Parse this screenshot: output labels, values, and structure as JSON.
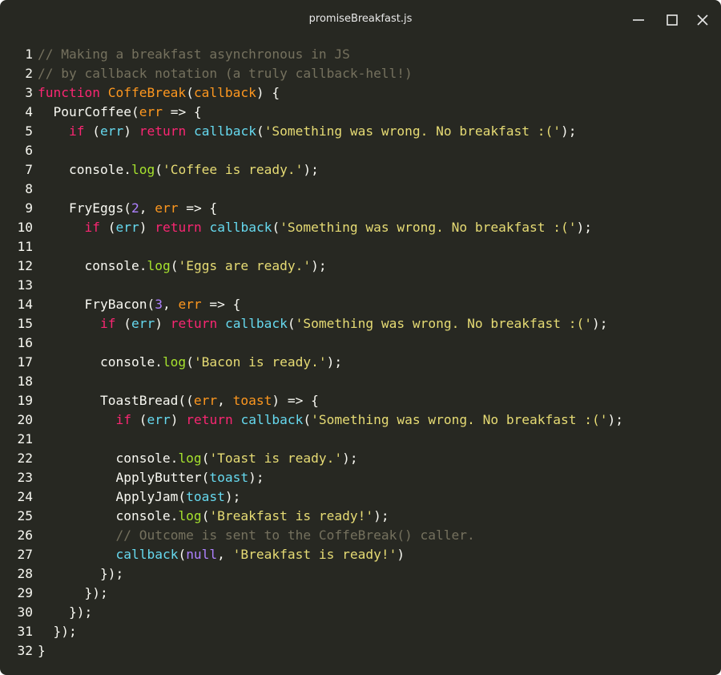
{
  "window": {
    "title": "promiseBreakfast.js",
    "controls": {
      "minimize_icon": "minimize-icon",
      "maximize_icon": "maximize-icon",
      "close_icon": "close-icon"
    }
  },
  "colors": {
    "background": "#272822",
    "default": "#f8f8f2",
    "comment": "#75715e",
    "keyword": "#f92672",
    "function_name": "#fd971f",
    "param": "#fd971f",
    "builtin": "#66d9ef",
    "method": "#a6e22e",
    "string": "#e6db74",
    "number": "#ae81ff"
  },
  "editor": {
    "lines": [
      {
        "num": "1",
        "tokens": [
          [
            "comment",
            "// Making a breakfast asynchronous in JS"
          ]
        ]
      },
      {
        "num": "2",
        "tokens": [
          [
            "comment",
            "// by callback notation (a truly callback-hell!)"
          ]
        ]
      },
      {
        "num": "3",
        "tokens": [
          [
            "keyword",
            "function"
          ],
          [
            "default",
            " "
          ],
          [
            "function-name",
            "CoffeBreak"
          ],
          [
            "default",
            "("
          ],
          [
            "param",
            "callback"
          ],
          [
            "default",
            ") {"
          ]
        ]
      },
      {
        "num": "4",
        "tokens": [
          [
            "default",
            "  PourCoffee("
          ],
          [
            "param",
            "err"
          ],
          [
            "default",
            " => {"
          ]
        ]
      },
      {
        "num": "5",
        "tokens": [
          [
            "default",
            "    "
          ],
          [
            "keyword",
            "if"
          ],
          [
            "default",
            " ("
          ],
          [
            "builtin",
            "err"
          ],
          [
            "default",
            ") "
          ],
          [
            "keyword",
            "return"
          ],
          [
            "default",
            " "
          ],
          [
            "builtin",
            "callback"
          ],
          [
            "default",
            "("
          ],
          [
            "string",
            "'Something was wrong. No breakfast :('"
          ],
          [
            "default",
            ");"
          ]
        ]
      },
      {
        "num": "6",
        "tokens": []
      },
      {
        "num": "7",
        "tokens": [
          [
            "default",
            "    console."
          ],
          [
            "method",
            "log"
          ],
          [
            "default",
            "("
          ],
          [
            "string",
            "'Coffee is ready.'"
          ],
          [
            "default",
            ");"
          ]
        ]
      },
      {
        "num": "8",
        "tokens": []
      },
      {
        "num": "9",
        "tokens": [
          [
            "default",
            "    FryEggs("
          ],
          [
            "number",
            "2"
          ],
          [
            "default",
            ", "
          ],
          [
            "param",
            "err"
          ],
          [
            "default",
            " => {"
          ]
        ]
      },
      {
        "num": "10",
        "tokens": [
          [
            "default",
            "      "
          ],
          [
            "keyword",
            "if"
          ],
          [
            "default",
            " ("
          ],
          [
            "builtin",
            "err"
          ],
          [
            "default",
            ") "
          ],
          [
            "keyword",
            "return"
          ],
          [
            "default",
            " "
          ],
          [
            "builtin",
            "callback"
          ],
          [
            "default",
            "("
          ],
          [
            "string",
            "'Something was wrong. No breakfast :('"
          ],
          [
            "default",
            ");"
          ]
        ]
      },
      {
        "num": "11",
        "tokens": []
      },
      {
        "num": "12",
        "tokens": [
          [
            "default",
            "      console."
          ],
          [
            "method",
            "log"
          ],
          [
            "default",
            "("
          ],
          [
            "string",
            "'Eggs are ready.'"
          ],
          [
            "default",
            ");"
          ]
        ]
      },
      {
        "num": "13",
        "tokens": []
      },
      {
        "num": "14",
        "tokens": [
          [
            "default",
            "      FryBacon("
          ],
          [
            "number",
            "3"
          ],
          [
            "default",
            ", "
          ],
          [
            "param",
            "err"
          ],
          [
            "default",
            " => {"
          ]
        ]
      },
      {
        "num": "15",
        "tokens": [
          [
            "default",
            "        "
          ],
          [
            "keyword",
            "if"
          ],
          [
            "default",
            " ("
          ],
          [
            "builtin",
            "err"
          ],
          [
            "default",
            ") "
          ],
          [
            "keyword",
            "return"
          ],
          [
            "default",
            " "
          ],
          [
            "builtin",
            "callback"
          ],
          [
            "default",
            "("
          ],
          [
            "string",
            "'Something was wrong. No breakfast :('"
          ],
          [
            "default",
            ");"
          ]
        ]
      },
      {
        "num": "16",
        "tokens": []
      },
      {
        "num": "17",
        "tokens": [
          [
            "default",
            "        console."
          ],
          [
            "method",
            "log"
          ],
          [
            "default",
            "("
          ],
          [
            "string",
            "'Bacon is ready.'"
          ],
          [
            "default",
            ");"
          ]
        ]
      },
      {
        "num": "18",
        "tokens": []
      },
      {
        "num": "19",
        "tokens": [
          [
            "default",
            "        ToastBread(("
          ],
          [
            "param",
            "err"
          ],
          [
            "default",
            ", "
          ],
          [
            "param",
            "toast"
          ],
          [
            "default",
            ") => {"
          ]
        ]
      },
      {
        "num": "20",
        "tokens": [
          [
            "default",
            "          "
          ],
          [
            "keyword",
            "if"
          ],
          [
            "default",
            " ("
          ],
          [
            "builtin",
            "err"
          ],
          [
            "default",
            ") "
          ],
          [
            "keyword",
            "return"
          ],
          [
            "default",
            " "
          ],
          [
            "builtin",
            "callback"
          ],
          [
            "default",
            "("
          ],
          [
            "string",
            "'Something was wrong. No breakfast :('"
          ],
          [
            "default",
            ");"
          ]
        ]
      },
      {
        "num": "21",
        "tokens": []
      },
      {
        "num": "22",
        "tokens": [
          [
            "default",
            "          console."
          ],
          [
            "method",
            "log"
          ],
          [
            "default",
            "("
          ],
          [
            "string",
            "'Toast is ready.'"
          ],
          [
            "default",
            ");"
          ]
        ]
      },
      {
        "num": "23",
        "tokens": [
          [
            "default",
            "          ApplyButter("
          ],
          [
            "builtin",
            "toast"
          ],
          [
            "default",
            ");"
          ]
        ]
      },
      {
        "num": "24",
        "tokens": [
          [
            "default",
            "          ApplyJam("
          ],
          [
            "builtin",
            "toast"
          ],
          [
            "default",
            ");"
          ]
        ]
      },
      {
        "num": "25",
        "tokens": [
          [
            "default",
            "          console."
          ],
          [
            "method",
            "log"
          ],
          [
            "default",
            "("
          ],
          [
            "string",
            "'Breakfast is ready!'"
          ],
          [
            "default",
            ");"
          ]
        ]
      },
      {
        "num": "26",
        "tokens": [
          [
            "default",
            "          "
          ],
          [
            "comment",
            "// Outcome is sent to the CoffeBreak() caller."
          ]
        ]
      },
      {
        "num": "27",
        "tokens": [
          [
            "default",
            "          "
          ],
          [
            "builtin",
            "callback"
          ],
          [
            "default",
            "("
          ],
          [
            "constant",
            "null"
          ],
          [
            "default",
            ", "
          ],
          [
            "string",
            "'Breakfast is ready!'"
          ],
          [
            "default",
            ")"
          ]
        ]
      },
      {
        "num": "28",
        "tokens": [
          [
            "default",
            "        });"
          ]
        ]
      },
      {
        "num": "29",
        "tokens": [
          [
            "default",
            "      });"
          ]
        ]
      },
      {
        "num": "30",
        "tokens": [
          [
            "default",
            "    });"
          ]
        ]
      },
      {
        "num": "31",
        "tokens": [
          [
            "default",
            "  });"
          ]
        ]
      },
      {
        "num": "32",
        "tokens": [
          [
            "default",
            "}"
          ]
        ]
      }
    ]
  }
}
